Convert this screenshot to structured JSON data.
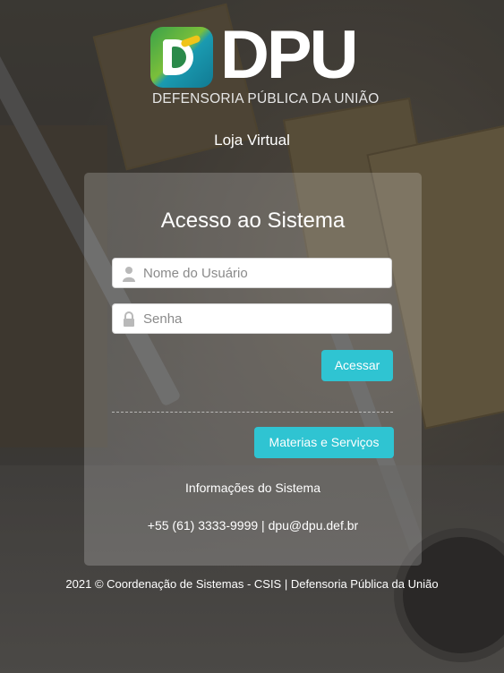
{
  "header": {
    "logo_text": "DPU",
    "logo_subtitle": "DEFENSORIA PÚBLICA DA UNIÃO",
    "store_title": "Loja Virtual"
  },
  "login": {
    "title": "Acesso ao Sistema",
    "username_placeholder": "Nome do Usuário",
    "username_value": "",
    "password_placeholder": "Senha",
    "password_value": "",
    "submit_label": "Acessar",
    "materials_label": "Materias e Serviços",
    "info_label": "Informações do Sistema",
    "contact": "+55 (61) 3333-9999 | dpu@dpu.def.br"
  },
  "footer": {
    "text": "2021 © Coordenação de Sistemas - CSIS | Defensoria Pública da União"
  },
  "colors": {
    "accent": "#2fc4d2",
    "panel": "rgba(255,255,255,0.20)"
  },
  "icons": {
    "username": "user-icon",
    "password": "lock-icon"
  }
}
